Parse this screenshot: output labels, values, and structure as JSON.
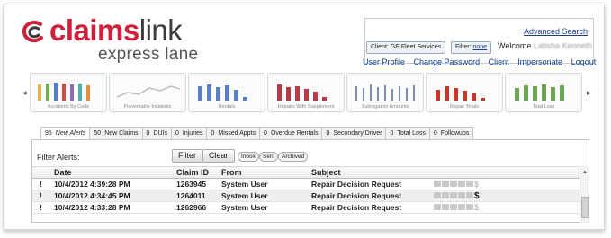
{
  "brand": {
    "name_part1": "claims",
    "name_part2": "link",
    "tagline": "express lane"
  },
  "header": {
    "advanced_search": "Advanced Search",
    "client_pill_label": "Client: GE Fleet Services",
    "filter_pill_label": "Filter: ",
    "filter_pill_value": "none",
    "welcome_label": "Welcome",
    "welcome_user": "Latisha Kenneth",
    "nav": [
      "User Profile",
      "Change Password",
      "Client",
      "Impersonate",
      "Logout"
    ]
  },
  "kpis": [
    {
      "label": "Accidents By Code",
      "chart": "bars-multi"
    },
    {
      "label": "Preventable Incidents",
      "chart": "line"
    },
    {
      "label": "Rentals",
      "chart": "bars-blue"
    },
    {
      "label": "Repairs With Supplement",
      "chart": "bars-red"
    },
    {
      "label": "Subrogation Amounts",
      "chart": "bars-thin"
    },
    {
      "label": "Repair Totals",
      "chart": "bars-red-sm"
    },
    {
      "label": "Total Loss",
      "chart": "bars-green"
    }
  ],
  "kpi_nav": {
    "prev": "◂",
    "next": "▸"
  },
  "tabs": [
    {
      "count": "95",
      "label": "New Alerts",
      "active": true
    },
    {
      "count": "50",
      "label": "New Claims"
    },
    {
      "count": "0",
      "label": "DUIs"
    },
    {
      "count": "0",
      "label": "Injuries"
    },
    {
      "count": "0",
      "label": "Missed Appts"
    },
    {
      "count": "0",
      "label": "Overdue Rentals"
    },
    {
      "count": "0",
      "label": "Secondary Driver"
    },
    {
      "count": "0",
      "label": "Total Loss"
    },
    {
      "count": "0",
      "label": "Followups"
    }
  ],
  "alerts": {
    "filter_label": "Filter Alerts:",
    "filter_button": "Filter",
    "clear_button": "Clear",
    "chips": [
      "Inbox",
      "Sent",
      "Archived"
    ],
    "columns": [
      "Date",
      "Claim ID",
      "From",
      "Subject"
    ],
    "rows": [
      {
        "flag": "!",
        "date": "10/4/2012 4:39:28 PM",
        "claim_id": "1263945",
        "from": "System User",
        "subject": "Repair Decision Request",
        "dollar_active": false
      },
      {
        "flag": "!",
        "date": "10/4/2012 4:34:45 PM",
        "claim_id": "1264011",
        "from": "System User",
        "subject": "Repair Decision Request",
        "dollar_active": true
      },
      {
        "flag": "!",
        "date": "10/4/2012 4:33:28 PM",
        "claim_id": "1262966",
        "from": "System User",
        "subject": "Repair Decision Request",
        "dollar_active": false
      }
    ],
    "row_dollar": "$",
    "scroll_up": "▲"
  }
}
